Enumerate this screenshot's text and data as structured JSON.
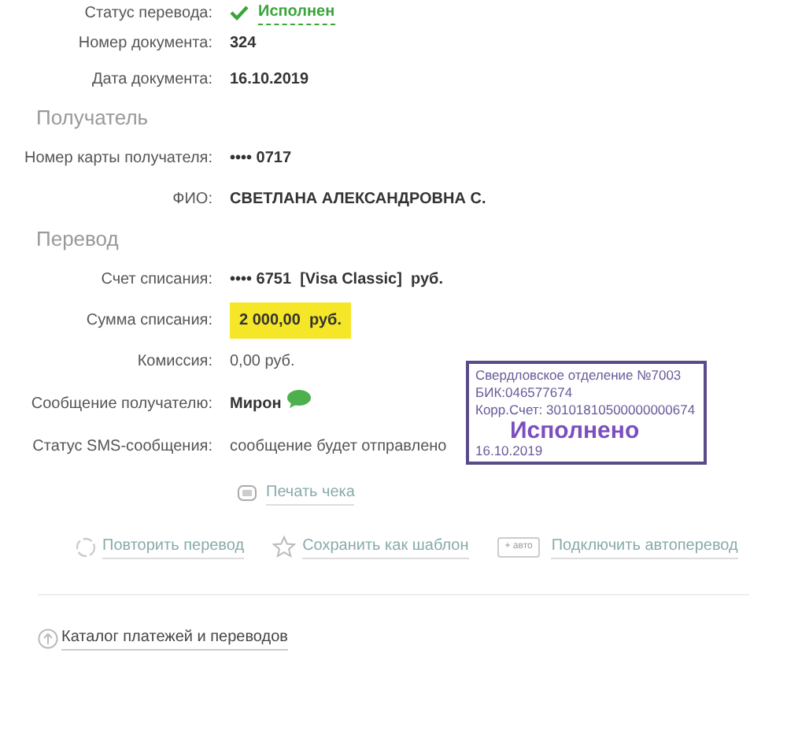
{
  "status_row": {
    "label": "Статус перевода:",
    "value": "Исполнен",
    "done": true
  },
  "doc_rows": [
    {
      "label": "Номер документа:",
      "value": "324"
    },
    {
      "label": "Дата документа:",
      "value": "16.10.2019"
    }
  ],
  "recipient": {
    "title": "Получатель",
    "rows": [
      {
        "label": "Номер карты получателя:",
        "value": "•••• 0717",
        "kind": "bold"
      },
      {
        "label": "ФИО:",
        "value": "СВЕТЛАНА АЛЕКСАНДРОВНА С.",
        "kind": "bold"
      }
    ]
  },
  "transfer": {
    "title": "Перевод",
    "rows": [
      {
        "label": "Счет списания:",
        "value": "•••• 6751  [Visa Classic]  руб.",
        "kind": "bold"
      },
      {
        "label": "Сумма списания:",
        "value": "2 000,00  руб.",
        "kind": "highlight"
      },
      {
        "label": "Комиссия:",
        "value": "0,00 руб.",
        "kind": "plain"
      },
      {
        "label": "Сообщение получателю:",
        "value": "Мирон",
        "kind": "sms"
      },
      {
        "label": "Статус SMS-сообщения:",
        "value": "сообщение будет отправлено",
        "kind": "plain"
      }
    ]
  },
  "print_link": "Печать чека",
  "actions": [
    {
      "kind": "repeat",
      "label": "Повторить перевод"
    },
    {
      "kind": "template",
      "label": "Сохранить как шаблон"
    },
    {
      "kind": "auto",
      "label": "Подключить автоперевод",
      "badge": "+ авто"
    }
  ],
  "catalog_link": "Каталог платежей и переводов",
  "stamp": {
    "lines": [
      "Свердловское отделение №7003",
      "БИК:046577674",
      "Корр.Счет: 30101810500000000674"
    ],
    "mark": "Исполнено",
    "date": "16.10.2019"
  }
}
